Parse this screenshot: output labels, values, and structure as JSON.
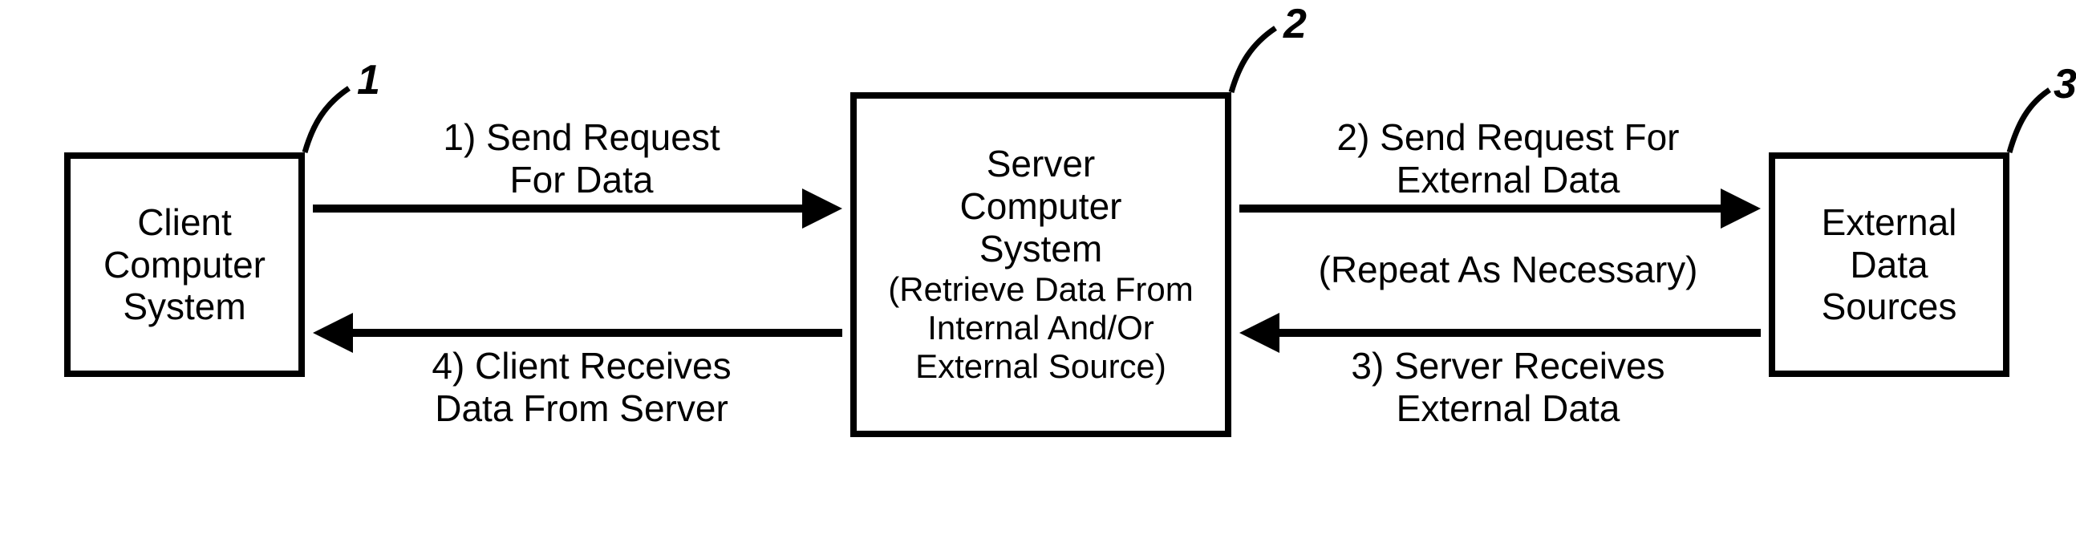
{
  "nodes": {
    "client": {
      "ref": "1",
      "line1": "Client",
      "line2": "Computer",
      "line3": "System"
    },
    "server": {
      "ref": "2",
      "line1": "Server",
      "line2": "Computer",
      "line3": "System",
      "sub1": "(Retrieve Data From",
      "sub2": "Internal And/Or",
      "sub3": "External Source)"
    },
    "external": {
      "ref": "3",
      "line1": "External",
      "line2": "Data",
      "line3": "Sources"
    }
  },
  "edges": {
    "e1": {
      "line1": "1) Send Request",
      "line2": "For Data"
    },
    "e2": {
      "line1": "2) Send Request For",
      "line2": "External Data"
    },
    "e2note": {
      "line1": "(Repeat As Necessary)"
    },
    "e3": {
      "line1": "3) Server Receives",
      "line2": "External Data"
    },
    "e4": {
      "line1": "4) Client Receives",
      "line2": "Data From Server"
    }
  }
}
